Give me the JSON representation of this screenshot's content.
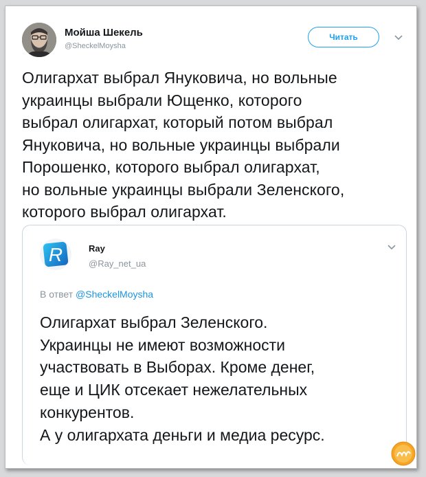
{
  "tweet": {
    "author_name": "Мойша Шекель",
    "author_handle": "@ShecкelMoysha",
    "follow_label": "Читать",
    "text": "Олигархат выбрал Януковича, но вольные\nукраинцы выбрали Ющенко, которого\nвыбрал олигархат, который потом выбрал\nЯнуковича, но вольные украинцы выбрали\nПорошенко, которого выбрал олигархат,\nно вольные украинцы выбрали Зеленского,\nкоторого выбрал олигархат."
  },
  "quoted": {
    "author_name": "Ray",
    "author_handle": "@Ray_net_ua",
    "avatar_letter": "R",
    "reply_prefix": "В ответ",
    "reply_to": "@ShecкelMoysha",
    "text": "Олигархат выбрал Зеленского.\nУкраинцы не имеют возможности\nучаствовать в Выборах. Кроме денег,\nеще и ЦИК отсекает нежелательных\nконкурентов.\nА у олигархата деньги и медиа ресурс."
  },
  "colors": {
    "accent": "#1da1f2",
    "link": "#1b95e0",
    "text": "#14171a",
    "muted": "#8a959e"
  },
  "icons": [
    "chevron-down-icon",
    "avatar-photo",
    "r-logo-avatar",
    "watermark-logo"
  ]
}
